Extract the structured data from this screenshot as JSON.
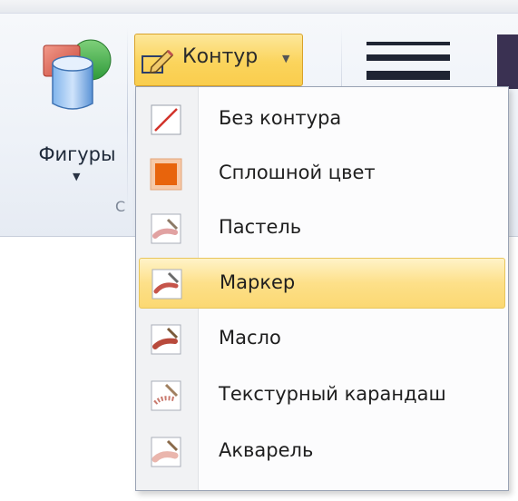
{
  "ribbon": {
    "shapes_button_label": "Фигуры",
    "group_label_fragment": "С",
    "outline_button_label": "Контур"
  },
  "outline_menu": {
    "items": [
      {
        "label": "Без контура",
        "icon": "no-outline-icon"
      },
      {
        "label": "Сплошной цвет",
        "icon": "solid-color-icon"
      },
      {
        "label": "Пастель",
        "icon": "pastel-brush-icon"
      },
      {
        "label": "Маркер",
        "icon": "marker-brush-icon",
        "highlighted": true
      },
      {
        "label": "Масло",
        "icon": "oil-brush-icon"
      },
      {
        "label": "Текстурный карандаш",
        "icon": "crayon-brush-icon"
      },
      {
        "label": "Акварель",
        "icon": "watercolor-brush-icon"
      }
    ]
  },
  "colors": {
    "highlight": "#fde089",
    "solid_swatch": "#e8640c",
    "accent_dark": "#3a3152"
  }
}
